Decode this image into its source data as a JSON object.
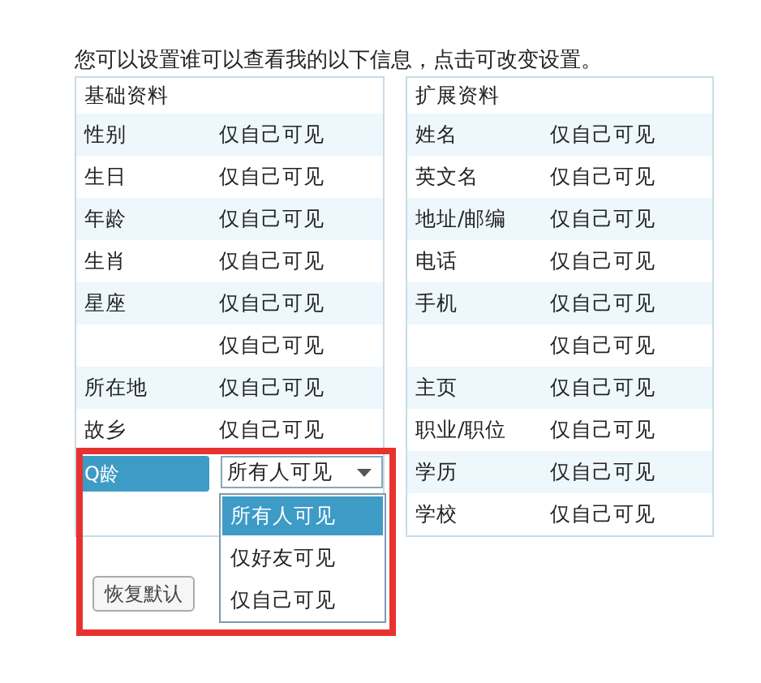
{
  "intro": "您可以设置谁可以查看我的以下信息，点击可改变设置。",
  "panels": [
    {
      "title": "基础资料",
      "rows": [
        {
          "kind": "text",
          "label": "性别",
          "value": "仅自己可见",
          "selected": false
        },
        {
          "kind": "text",
          "label": "生日",
          "value": "仅自己可见",
          "selected": false
        },
        {
          "kind": "text",
          "label": "年龄",
          "value": "仅自己可见",
          "selected": false
        },
        {
          "kind": "text",
          "label": "生肖",
          "value": "仅自己可见",
          "selected": false
        },
        {
          "kind": "text",
          "label": "星座",
          "value": "仅自己可见",
          "selected": false
        },
        {
          "kind": "text",
          "value": "仅自己可见",
          "selected": false
        },
        {
          "kind": "text",
          "label": "所在地",
          "value": "仅自己可见",
          "selected": false
        },
        {
          "kind": "text",
          "label": "故乡",
          "value": "仅自己可见",
          "selected": false
        },
        {
          "kind": "dropdown",
          "label": "Q龄",
          "value": "所有人可见",
          "selected": true,
          "expanded": true,
          "options": [
            {
              "label": "所有人可见",
              "selected": true
            },
            {
              "label": "仅好友可见",
              "selected": false
            },
            {
              "label": "仅自己可见",
              "selected": false
            }
          ]
        }
      ]
    },
    {
      "title": "扩展资料",
      "rows": [
        {
          "kind": "text",
          "label": "姓名",
          "value": "仅自己可见",
          "selected": false
        },
        {
          "kind": "text",
          "label": "英文名",
          "value": "仅自己可见",
          "selected": false
        },
        {
          "kind": "text",
          "label": "地址/邮编",
          "value": "仅自己可见",
          "selected": false
        },
        {
          "kind": "text",
          "label": "电话",
          "value": "仅自己可见",
          "selected": false
        },
        {
          "kind": "text",
          "label": "手机",
          "value": "仅自己可见",
          "selected": false
        },
        {
          "kind": "text",
          "value": "仅自己可见",
          "selected": false
        },
        {
          "kind": "text",
          "label": "主页",
          "value": "仅自己可见",
          "selected": false
        },
        {
          "kind": "text",
          "label": "职业/职位",
          "value": "仅自己可见",
          "selected": false
        },
        {
          "kind": "text",
          "label": "学历",
          "value": "仅自己可见",
          "selected": false
        },
        {
          "kind": "text",
          "label": "学校",
          "value": "仅自己可见",
          "selected": false
        }
      ]
    }
  ],
  "buttons": [
    "恢复默认"
  ]
}
